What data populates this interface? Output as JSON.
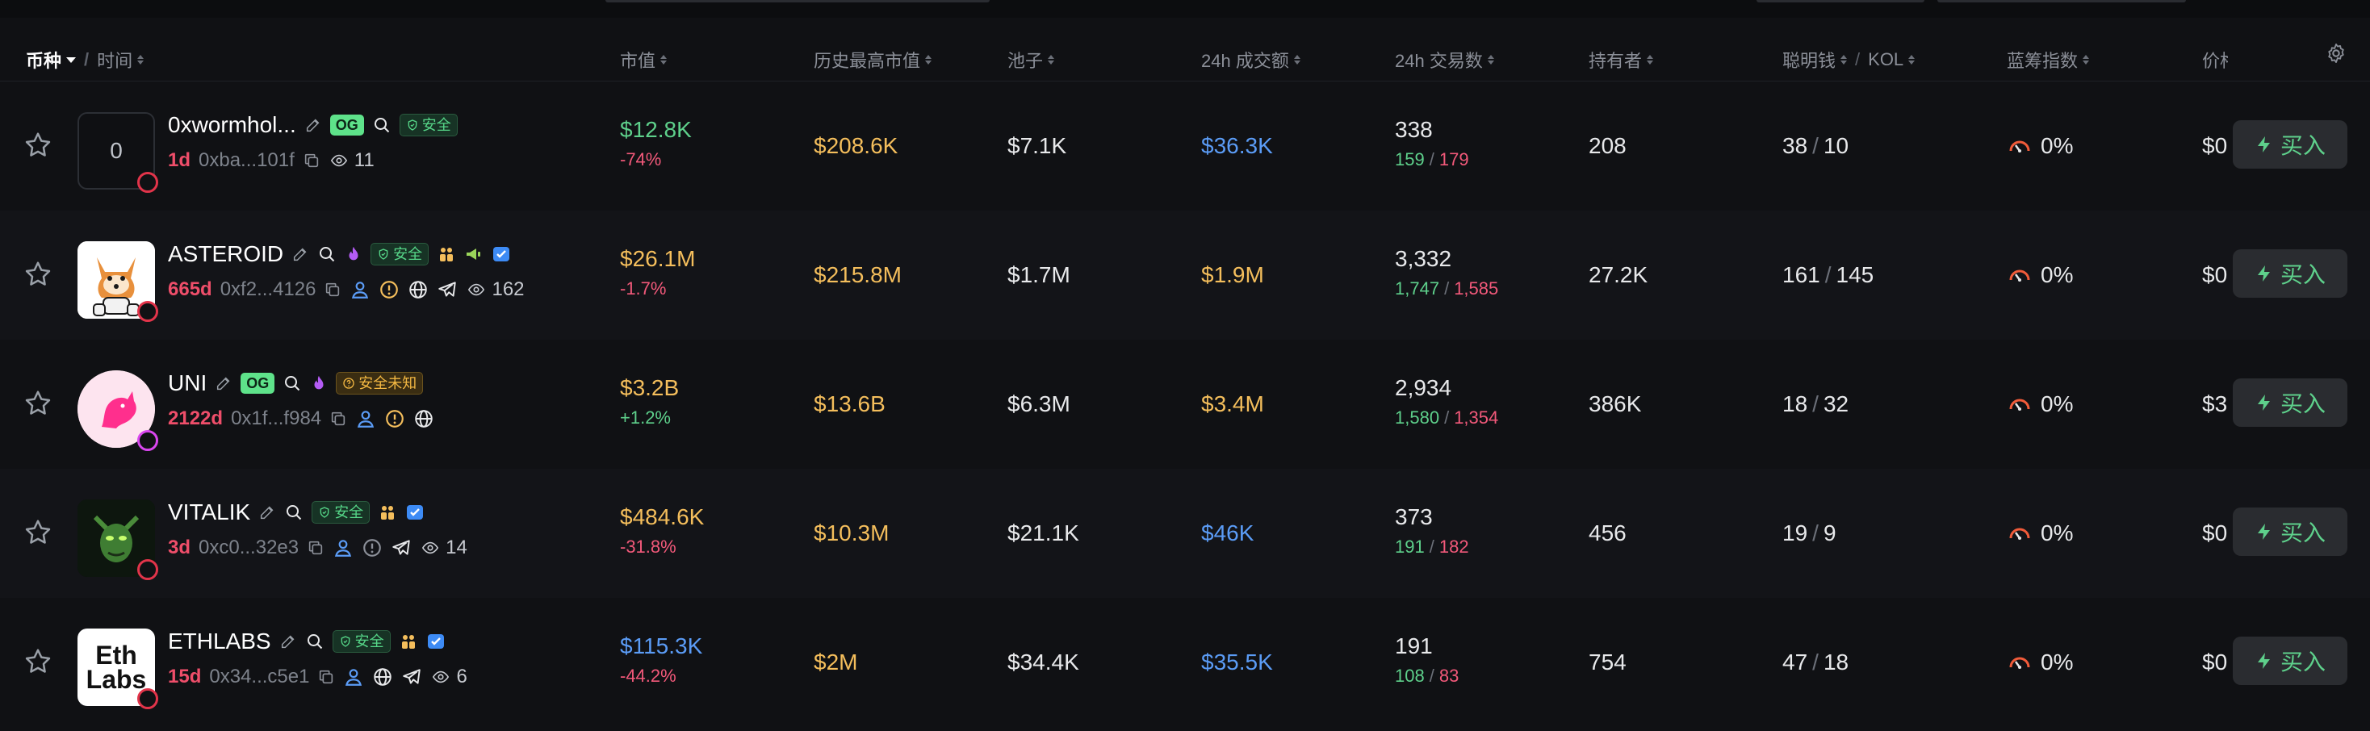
{
  "columns": {
    "coin": "币种",
    "time": "时间",
    "market_cap": "市值",
    "ath_market_cap": "历史最高市值",
    "pool": "池子",
    "volume_24h": "24h 成交额",
    "txns_24h": "24h 交易数",
    "holders": "持有者",
    "smart_money": "聪明钱",
    "kol": "KOL",
    "bluechip": "蓝筹指数",
    "price": "价格"
  },
  "icons": {
    "star": "star-icon",
    "edit": "pencil-icon",
    "search": "search-icon",
    "fire": "fire-icon",
    "shield": "shield-icon",
    "copy": "copy-icon",
    "user": "user-icon",
    "globe": "globe-icon",
    "telegram": "telegram-icon",
    "eye": "eye-icon",
    "warn": "warning-icon",
    "bolt": "lightning-icon",
    "gear": "gear-icon"
  },
  "colors": {
    "green": "#5ed08b",
    "red": "#f2597a",
    "yellow": "#f4be5c",
    "blue": "#5b9cf6",
    "age": "#ef4e6a"
  },
  "tags": {
    "og": "OG",
    "safe": "安全",
    "unknown": "安全未知"
  },
  "rows": [
    {
      "avatar_text": "0",
      "name": "0xwormhol...",
      "age": "1d",
      "address": "0xba...101f",
      "views": "11",
      "market_cap": "$12.8K",
      "change": "-74%",
      "ath": "$208.6K",
      "pool": "$7.1K",
      "volume": "$36.3K",
      "txns": "338",
      "buys": "159",
      "sells": "179",
      "holders": "208",
      "smart": "38",
      "kol": "10",
      "bluechip": "0%",
      "price": "$0",
      "buy": "买入"
    },
    {
      "name": "ASTEROID",
      "age": "665d",
      "address": "0xf2...4126",
      "views": "162",
      "market_cap": "$26.1M",
      "change": "-1.7%",
      "ath": "$215.8M",
      "pool": "$1.7M",
      "volume": "$1.9M",
      "txns": "3,332",
      "buys": "1,747",
      "sells": "1,585",
      "holders": "27.2K",
      "smart": "161",
      "kol": "145",
      "bluechip": "0%",
      "price": "$0",
      "buy": "买入"
    },
    {
      "name": "UNI",
      "age": "2122d",
      "address": "0x1f...f984",
      "market_cap": "$3.2B",
      "change": "+1.2%",
      "ath": "$13.6B",
      "pool": "$6.3M",
      "volume": "$3.4M",
      "txns": "2,934",
      "buys": "1,580",
      "sells": "1,354",
      "holders": "386K",
      "smart": "18",
      "kol": "32",
      "bluechip": "0%",
      "price": "$3",
      "buy": "买入"
    },
    {
      "name": "VITALIK",
      "age": "3d",
      "address": "0xc0...32e3",
      "views": "14",
      "market_cap": "$484.6K",
      "change": "-31.8%",
      "ath": "$10.3M",
      "pool": "$21.1K",
      "volume": "$46K",
      "txns": "373",
      "buys": "191",
      "sells": "182",
      "holders": "456",
      "smart": "19",
      "kol": "9",
      "bluechip": "0%",
      "price": "$0",
      "buy": "买入"
    },
    {
      "avatar_text_1": "Eth",
      "avatar_text_2": "Labs",
      "name": "ETHLABS",
      "age": "15d",
      "address": "0x34...c5e1",
      "views": "6",
      "market_cap": "$115.3K",
      "change": "-44.2%",
      "ath": "$2M",
      "pool": "$34.4K",
      "volume": "$35.5K",
      "txns": "191",
      "buys": "108",
      "sells": "83",
      "holders": "754",
      "smart": "47",
      "kol": "18",
      "bluechip": "0%",
      "price": "$0",
      "buy": "买入"
    }
  ]
}
